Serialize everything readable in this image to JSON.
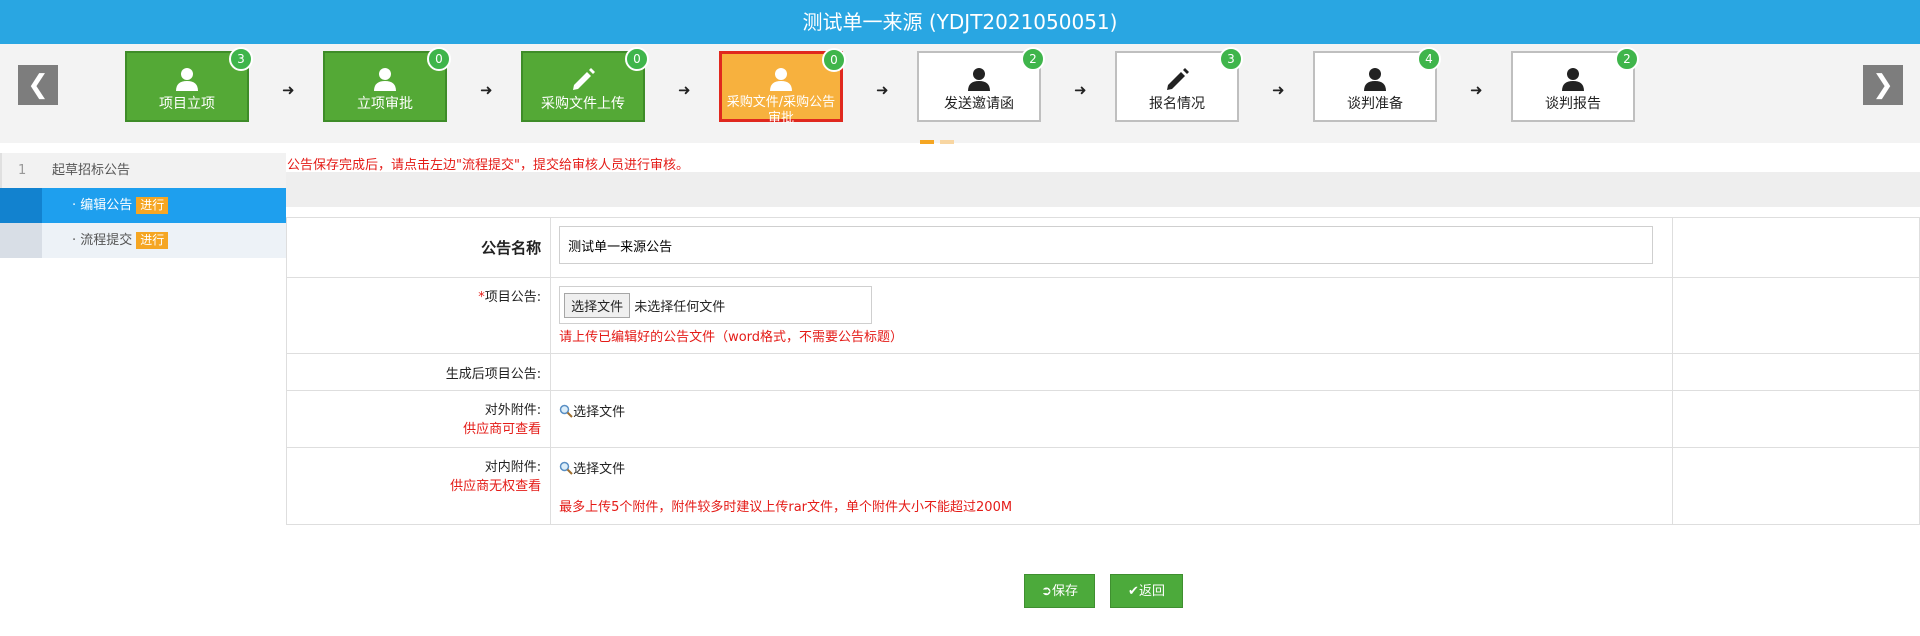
{
  "title": "测试单一来源 (YDJT2021050051)",
  "nav": {
    "prev": "❮",
    "next": "❯"
  },
  "steps": [
    {
      "label": "项目立项",
      "count": "3",
      "icon": "user-icon",
      "state": "done"
    },
    {
      "label": "立项审批",
      "count": "0",
      "icon": "user-icon",
      "state": "done"
    },
    {
      "label": "采购文件上传",
      "count": "0",
      "icon": "pencil-icon",
      "state": "done"
    },
    {
      "label": "采购文件/采购公告审批",
      "count": "0",
      "icon": "user-icon",
      "state": "active"
    },
    {
      "label": "发送邀请函",
      "count": "2",
      "icon": "user-icon",
      "state": "pending"
    },
    {
      "label": "报名情况",
      "count": "3",
      "icon": "pencil-icon",
      "state": "pending"
    },
    {
      "label": "谈判准备",
      "count": "4",
      "icon": "user-icon",
      "state": "pending"
    },
    {
      "label": "谈判报告",
      "count": "2",
      "icon": "user-icon",
      "state": "pending"
    }
  ],
  "sidebar": {
    "head": {
      "num": "1",
      "label": "起草招标公告"
    },
    "items": [
      {
        "label": "· 编辑公告",
        "tag": "进行",
        "selected": true
      },
      {
        "label": "· 流程提交",
        "tag": "进行",
        "selected": false
      }
    ]
  },
  "notice": "公告保存完成后，请点击左边\"流程提交\"，提交给审核人员进行审核。",
  "form": {
    "name_label": "公告名称",
    "name_value": "测试单一来源公告",
    "project_required_mark": "*",
    "project_label": "项目公告:",
    "choose_file": "选择文件",
    "no_file": "未选择任何文件",
    "project_hint": "请上传已编辑好的公告文件（word格式，不需要公告标题）",
    "generated_label": "生成后项目公告:",
    "external_label": "对外附件:",
    "external_note": "供应商可查看",
    "internal_label": "对内附件:",
    "internal_note": "供应商无权查看",
    "pick_file": "选择文件",
    "attach_hint": "最多上传5个附件，附件较多时建议上传rar文件，单个附件大小不能超过200M"
  },
  "buttons": {
    "save": "保存",
    "back": "返回"
  },
  "colors": {
    "header": "#29a6e2",
    "done": "#54a936",
    "active": "#f7b13e",
    "badge": "#3fb54b",
    "alert": "#e41b17"
  }
}
